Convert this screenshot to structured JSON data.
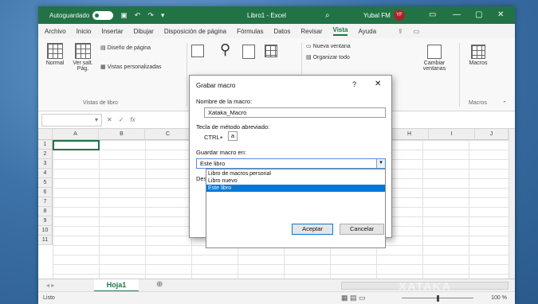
{
  "titlebar": {
    "autosave_label": "Autoguardado",
    "doc_title": "Libro1 - Excel",
    "user_name": "Yubal FM",
    "user_initials": "YF"
  },
  "menu": [
    "Archivo",
    "Inicio",
    "Insertar",
    "Dibujar",
    "Disposición de página",
    "Fórmulas",
    "Datos",
    "Revisar",
    "Vista",
    "Ayuda"
  ],
  "menu_active": "Vista",
  "ribbon": {
    "normal": "Normal",
    "ver_salt": "Ver salt.",
    "pag": "Pág.",
    "diseno_pagina": "Diseño de página",
    "vistas_personalizadas": "Vistas personalizadas",
    "vistas_libro": "Vistas de libro",
    "nueva_ventana": "Nueva ventana",
    "organizar_todo": "Organizar todo",
    "cambiar": "Cambiar",
    "ventanas": "ventanas",
    "macros": "Macros",
    "macros_group": "Macros"
  },
  "formula": {
    "fx": "fx"
  },
  "columns": [
    "A",
    "B",
    "C",
    "H",
    "I",
    "J"
  ],
  "rows": [
    "1",
    "2",
    "3",
    "4",
    "5",
    "6",
    "7",
    "8",
    "9",
    "10",
    "11"
  ],
  "sheet_tab": "Hoja1",
  "status": {
    "ready": "Listo",
    "zoom": "100 %"
  },
  "dialog": {
    "title": "Grabar macro",
    "help": "?",
    "close": "✕",
    "name_label": "Nombre de la macro:",
    "name_value": "Xataka_Macro",
    "shortcut_label": "Tecla de método abreviado:",
    "shortcut_prefix": "CTRL+",
    "shortcut_value": "a",
    "store_label": "Guardar macro en:",
    "store_value": "Este libro",
    "options": [
      "Libro de macros personal",
      "Libro nuevo",
      "Este libro"
    ],
    "desc_label": "Des",
    "ok": "Aceptar",
    "cancel": "Cancelar"
  },
  "watermark": "XATAKA"
}
